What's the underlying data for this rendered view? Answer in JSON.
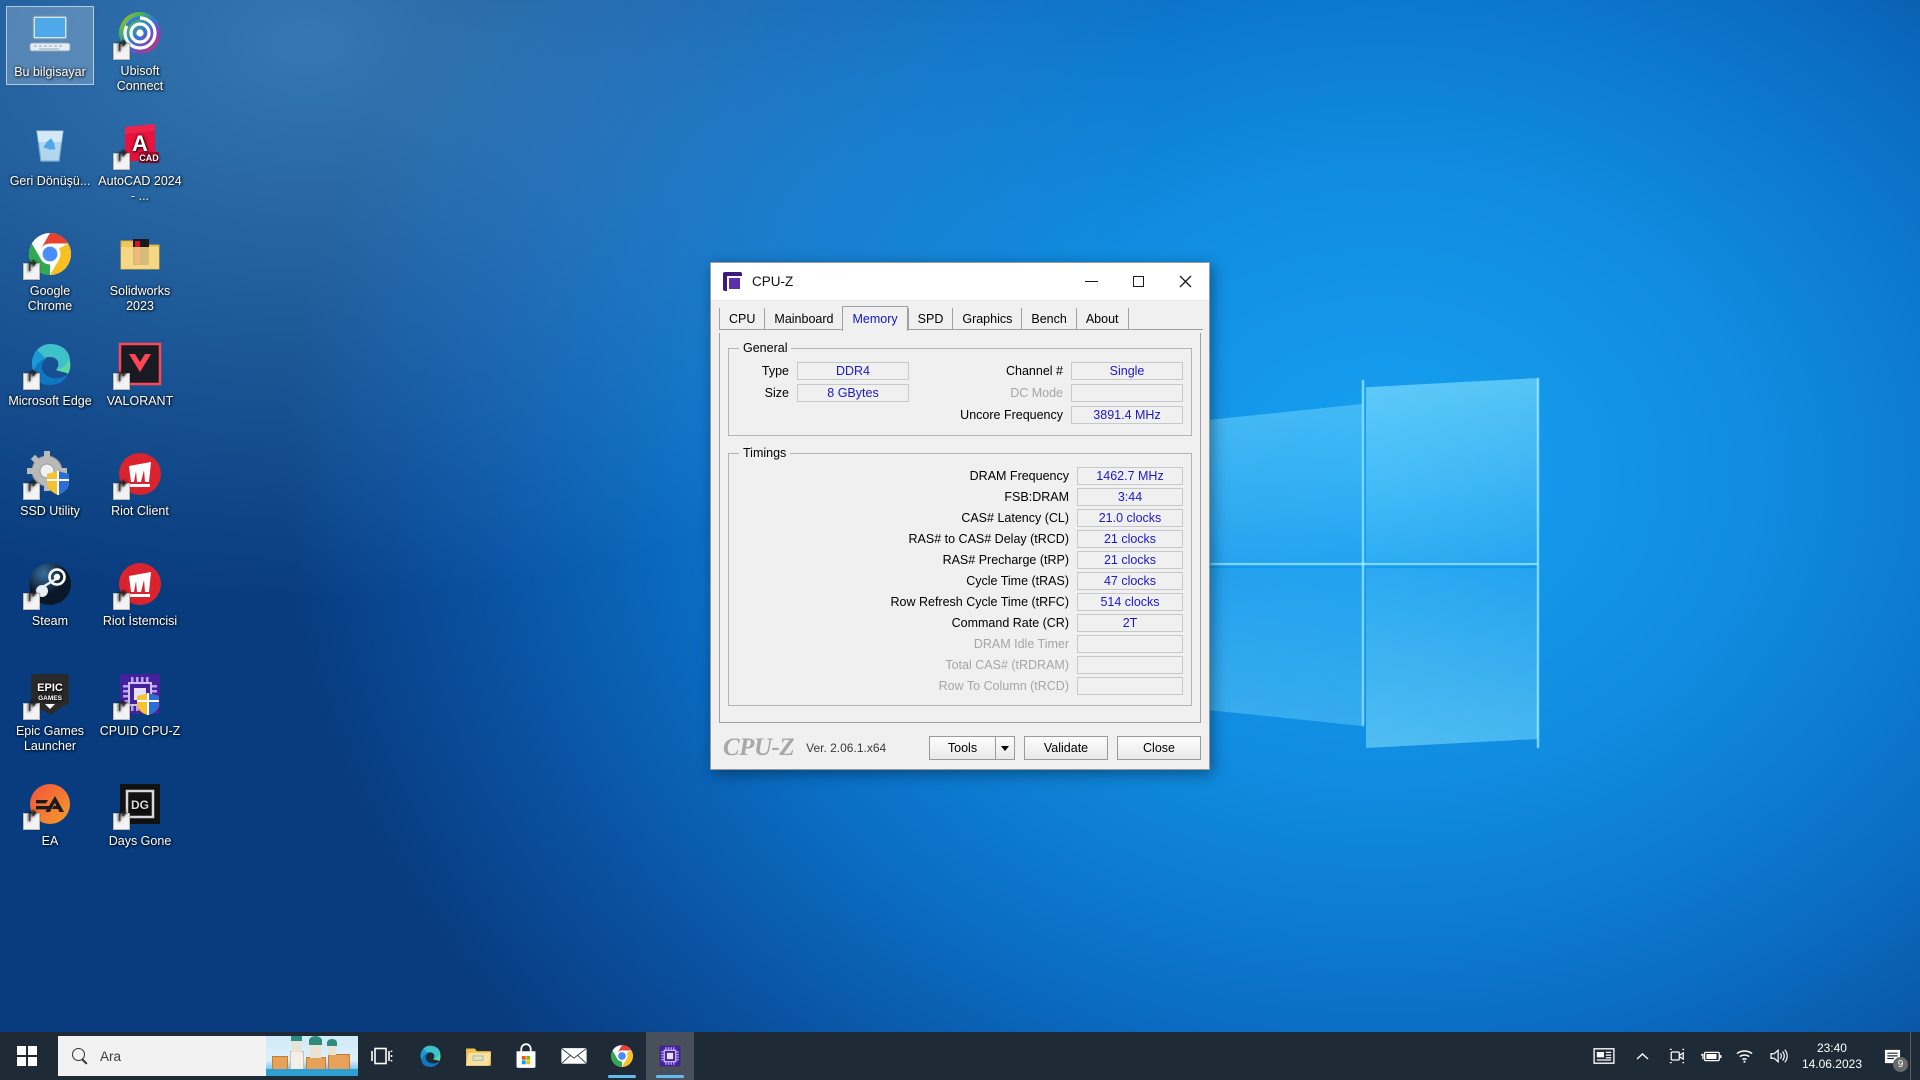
{
  "desktop": {
    "icons": [
      {
        "name": "this-pc",
        "label": "Bu bilgisayar",
        "icon": "monitor-icon",
        "selected": true,
        "shortcut": false
      },
      {
        "name": "ubisoft-connect",
        "label": "Ubisoft Connect",
        "icon": "ubisoft-icon",
        "selected": false,
        "shortcut": true
      },
      {
        "name": "recycle-bin",
        "label": "Geri Dönüşü...",
        "icon": "recycle-bin-icon",
        "selected": false,
        "shortcut": false
      },
      {
        "name": "autocad",
        "label": "AutoCAD 2024 - ...",
        "icon": "autocad-icon",
        "selected": false,
        "shortcut": true
      },
      {
        "name": "google-chrome",
        "label": "Google Chrome",
        "icon": "chrome-icon",
        "selected": false,
        "shortcut": true
      },
      {
        "name": "solidworks",
        "label": "Solidworks 2023",
        "icon": "folder-icon",
        "selected": false,
        "shortcut": false
      },
      {
        "name": "microsoft-edge",
        "label": "Microsoft Edge",
        "icon": "edge-icon",
        "selected": false,
        "shortcut": true
      },
      {
        "name": "valorant",
        "label": "VALORANT",
        "icon": "valorant-icon",
        "selected": false,
        "shortcut": true
      },
      {
        "name": "ssd-utility",
        "label": "SSD Utility",
        "icon": "gear-shield-icon",
        "selected": false,
        "shortcut": true
      },
      {
        "name": "riot-client",
        "label": "Riot Client",
        "icon": "riot-icon",
        "selected": false,
        "shortcut": true
      },
      {
        "name": "steam",
        "label": "Steam",
        "icon": "steam-icon",
        "selected": false,
        "shortcut": true
      },
      {
        "name": "riot-istemcisi",
        "label": "Riot İstemcisi",
        "icon": "riot-icon",
        "selected": false,
        "shortcut": true
      },
      {
        "name": "epic-games",
        "label": "Epic Games Launcher",
        "icon": "epic-games-icon",
        "selected": false,
        "shortcut": true
      },
      {
        "name": "cpuid-cpuz",
        "label": "CPUID CPU-Z",
        "icon": "cpuz-shield-icon",
        "selected": false,
        "shortcut": true
      },
      {
        "name": "ea",
        "label": "EA",
        "icon": "ea-icon",
        "selected": false,
        "shortcut": true
      },
      {
        "name": "days-gone",
        "label": "Days Gone",
        "icon": "days-gone-icon",
        "selected": false,
        "shortcut": true
      }
    ]
  },
  "cpuz": {
    "title": "CPU-Z",
    "window_controls": {
      "minimize": "Minimize",
      "maximize": "Maximize",
      "close": "Close"
    },
    "tabs": [
      {
        "label": "CPU",
        "active": false
      },
      {
        "label": "Mainboard",
        "active": false
      },
      {
        "label": "Memory",
        "active": true
      },
      {
        "label": "SPD",
        "active": false
      },
      {
        "label": "Graphics",
        "active": false
      },
      {
        "label": "Bench",
        "active": false
      },
      {
        "label": "About",
        "active": false
      }
    ],
    "general": {
      "legend": "General",
      "left": [
        {
          "label": "Type",
          "value": "DDR4",
          "disabled": false
        },
        {
          "label": "Size",
          "value": "8 GBytes",
          "disabled": false
        }
      ],
      "right": [
        {
          "label": "Channel #",
          "value": "Single",
          "disabled": false
        },
        {
          "label": "DC Mode",
          "value": "",
          "disabled": true
        },
        {
          "label": "Uncore Frequency",
          "value": "3891.4 MHz",
          "disabled": false
        }
      ]
    },
    "timings": {
      "legend": "Timings",
      "rows": [
        {
          "label": "DRAM Frequency",
          "value": "1462.7 MHz",
          "disabled": false
        },
        {
          "label": "FSB:DRAM",
          "value": "3:44",
          "disabled": false
        },
        {
          "label": "CAS# Latency (CL)",
          "value": "21.0 clocks",
          "disabled": false
        },
        {
          "label": "RAS# to CAS# Delay (tRCD)",
          "value": "21 clocks",
          "disabled": false
        },
        {
          "label": "RAS# Precharge (tRP)",
          "value": "21 clocks",
          "disabled": false
        },
        {
          "label": "Cycle Time (tRAS)",
          "value": "47 clocks",
          "disabled": false
        },
        {
          "label": "Row Refresh Cycle Time (tRFC)",
          "value": "514 clocks",
          "disabled": false
        },
        {
          "label": "Command Rate (CR)",
          "value": "2T",
          "disabled": false
        },
        {
          "label": "DRAM Idle Timer",
          "value": "",
          "disabled": true
        },
        {
          "label": "Total CAS# (tRDRAM)",
          "value": "",
          "disabled": true
        },
        {
          "label": "Row To Column (tRCD)",
          "value": "",
          "disabled": true
        }
      ]
    },
    "footer": {
      "logo": "CPU-Z",
      "version": "Ver. 2.06.1.x64",
      "tools_label": "Tools",
      "tools_dropdown": "tools-dropdown",
      "validate_label": "Validate",
      "close_label": "Close"
    },
    "accent_value_color": "#1f17c9",
    "disabled_color": "#a6a6a6"
  },
  "taskbar": {
    "start": "start-button",
    "search": {
      "placeholder": "Ara",
      "icon": "search-icon"
    },
    "task_view": "task-view-icon",
    "items": [
      {
        "name": "taskbar-edge",
        "label": "Microsoft Edge",
        "icon": "edge-icon",
        "active": false,
        "running": false
      },
      {
        "name": "taskbar-explorer",
        "label": "File Explorer",
        "icon": "folder-icon",
        "active": false,
        "running": false
      },
      {
        "name": "taskbar-store",
        "label": "Microsoft Store",
        "icon": "store-icon",
        "active": false,
        "running": false
      },
      {
        "name": "taskbar-mail",
        "label": "Mail",
        "icon": "mail-icon",
        "active": false,
        "running": false
      },
      {
        "name": "taskbar-chrome",
        "label": "Google Chrome",
        "icon": "chrome-icon",
        "active": false,
        "running": true
      },
      {
        "name": "taskbar-cpuz",
        "label": "CPU-Z",
        "icon": "cpuz-icon",
        "active": true,
        "running": true
      }
    ],
    "tray": [
      {
        "name": "news-and-interests",
        "icon": "news-icon"
      },
      {
        "name": "show-hidden-icons",
        "icon": "chevron-up-icon"
      },
      {
        "name": "camera-status",
        "icon": "camera-icon"
      },
      {
        "name": "battery",
        "icon": "battery-icon"
      },
      {
        "name": "network",
        "icon": "wifi-icon"
      },
      {
        "name": "volume",
        "icon": "speaker-icon"
      }
    ],
    "clock": {
      "time": "23:40",
      "date": "14.06.2023"
    },
    "notifications": {
      "icon": "notification-icon",
      "count": "9"
    }
  },
  "colors": {
    "taskbar_bg": "#1f2a37",
    "desktop_blue": "#0c7ad4",
    "cpuz_value_blue": "#1f17c9",
    "running_underline": "#68b9f0"
  }
}
